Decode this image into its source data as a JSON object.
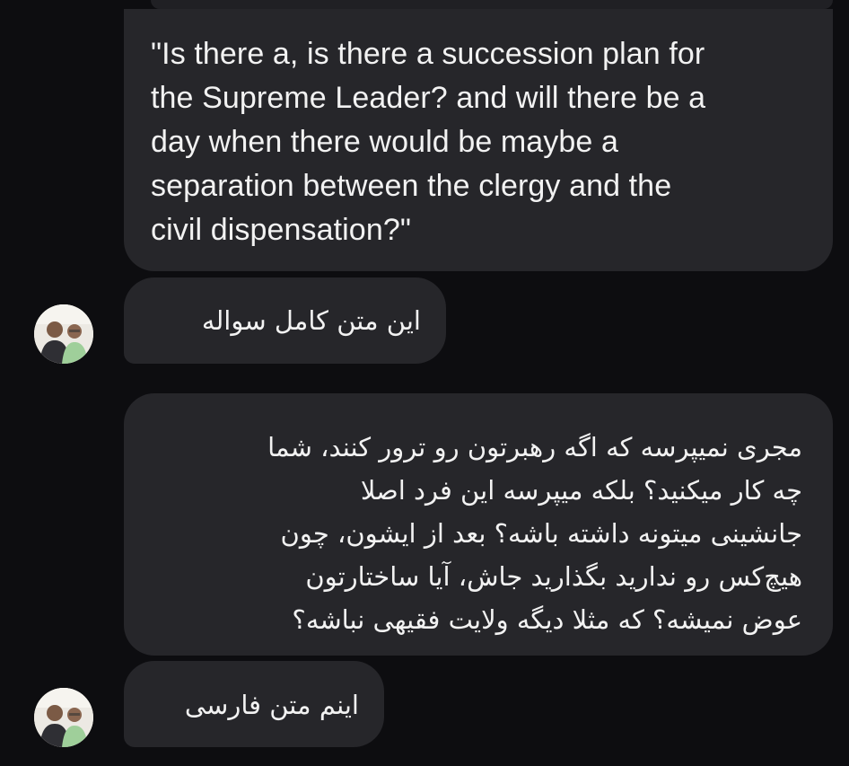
{
  "conversation": {
    "messages": [
      {
        "text": "\"Is there a, is there a succession plan for\nthe Supreme Leader? and will there be a\nday when there would be maybe a\nseparation between the clergy and the\ncivil dispensation?\""
      },
      {
        "text": "این متن کامل سواله"
      },
      {
        "text": "مجری نمیپرسه که اگه رهبرتون رو ترور کنند، شما\nچه کار میکنید؟ بلکه میپرسه این فرد اصلا\nجانشینی میتونه داشته باشه؟ بعد از ایشون، چون\nهیچ‌کس رو ندارید بگذارید جاش، آیا ساختارتون\nعوض نمیشه؟ که مثلا دیگه ولایت فقیهی نباشه؟"
      },
      {
        "text": "اینم متن فارسی"
      }
    ],
    "avatar_icon": "two-people-photo-icon"
  },
  "colors": {
    "background": "#0d0d10",
    "bubble": "#26262a",
    "text": "#f2f2f2"
  }
}
